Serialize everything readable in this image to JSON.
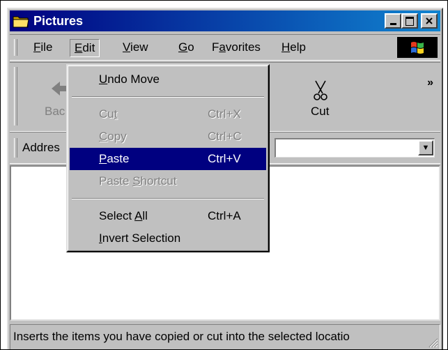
{
  "window": {
    "title": "Pictures"
  },
  "menubar": {
    "items": [
      {
        "pre": "",
        "u": "F",
        "post": "ile"
      },
      {
        "pre": "",
        "u": "E",
        "post": "dit"
      },
      {
        "pre": "",
        "u": "V",
        "post": "iew"
      },
      {
        "pre": "",
        "u": "G",
        "post": "o"
      },
      {
        "pre": "F",
        "u": "a",
        "post": "vorites"
      },
      {
        "pre": "",
        "u": "H",
        "post": "elp"
      }
    ]
  },
  "toolbar": {
    "back_label": "Bac",
    "cut_label": "Cut",
    "chevron": "»"
  },
  "address": {
    "label": "Addres"
  },
  "edit_menu": {
    "undo": {
      "pre": "",
      "u": "U",
      "post": "ndo Move"
    },
    "cut": {
      "pre": "Cu",
      "u": "t",
      "post": "",
      "shortcut": "Ctrl+X"
    },
    "copy": {
      "pre": "",
      "u": "C",
      "post": "opy",
      "shortcut": "Ctrl+C"
    },
    "paste": {
      "pre": "",
      "u": "P",
      "post": "aste",
      "shortcut": "Ctrl+V"
    },
    "paste_shortcut": {
      "pre": "Paste ",
      "u": "S",
      "post": "hortcut"
    },
    "select_all": {
      "pre": "Select ",
      "u": "A",
      "post": "ll",
      "shortcut": "Ctrl+A"
    },
    "invert": {
      "pre": "",
      "u": "I",
      "post": "nvert Selection"
    }
  },
  "status": {
    "text": "Inserts the items you have copied or cut into the selected locatio"
  },
  "colors": {
    "titlebar": "#000080",
    "highlight": "#000080",
    "face": "#c0c0c0"
  }
}
